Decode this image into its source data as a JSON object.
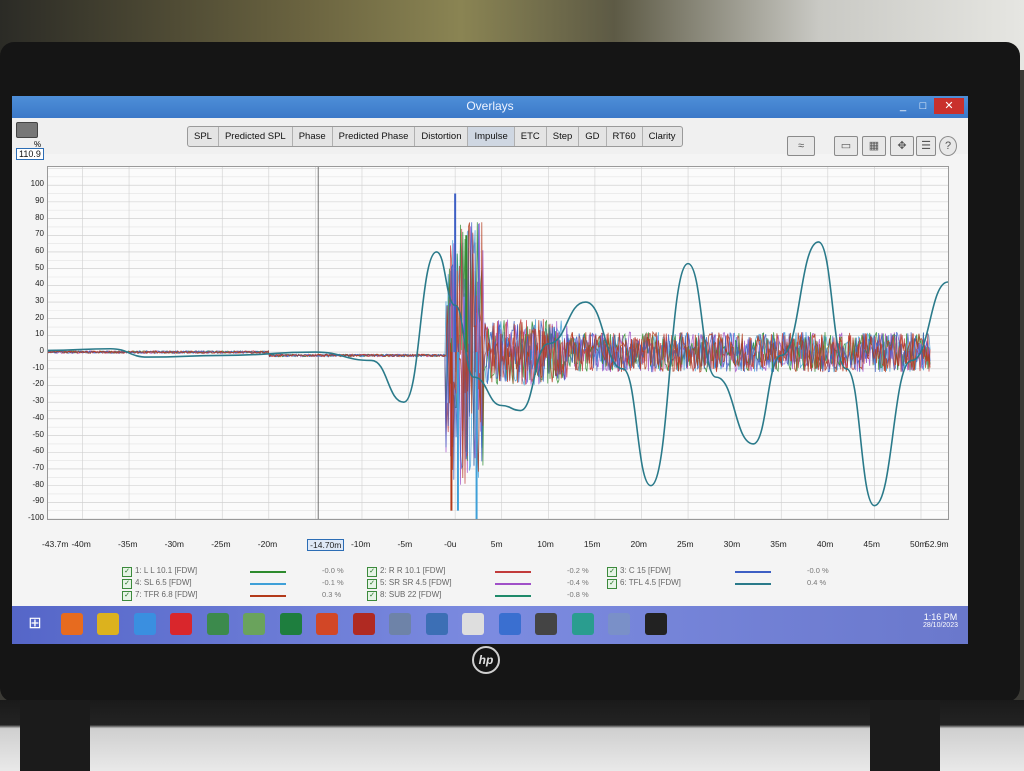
{
  "window": {
    "title": "Overlays",
    "min": "_",
    "max": "□",
    "close": "✕"
  },
  "toolbar": {
    "y_value": "110.9",
    "y_unit": "%",
    "tabs": [
      "SPL",
      "Predicted SPL",
      "Phase",
      "Predicted Phase",
      "Distortion",
      "Impulse",
      "ETC",
      "Step",
      "GD",
      "RT60",
      "Clarity"
    ],
    "active_tab": "Impulse",
    "icons": [
      "overlay-chart-icon",
      "monitor-icon",
      "grid-icon",
      "arrows-icon",
      "controls-icon",
      "help-icon"
    ]
  },
  "chart_data": {
    "type": "line",
    "ylabel": "%",
    "ylim": [
      -100,
      110.9
    ],
    "xlim": [
      -43.7,
      52.9
    ],
    "y_ticks": [
      "100",
      "90",
      "80",
      "70",
      "60",
      "50",
      "40",
      "30",
      "20",
      "10",
      "0",
      "-10",
      "-20",
      "-30",
      "-40",
      "-50",
      "-60",
      "-70",
      "-80",
      "-90",
      "-100"
    ],
    "x_ticks": [
      "-43.7m",
      "-40m",
      "-35m",
      "-30m",
      "-25m",
      "-20m",
      "-14.70m",
      "-10m",
      "-5m",
      "-0u",
      "5m",
      "10m",
      "15m",
      "20m",
      "25m",
      "30m",
      "35m",
      "40m",
      "45m",
      "50m",
      "52.9m"
    ],
    "cursor_x": "-14.70m",
    "grid": true,
    "series": [
      {
        "name": "1: L L 10.1 [FDW]",
        "color": "#2e8b2e",
        "offset": "-0.0 %"
      },
      {
        "name": "2: R R 10.1 [FDW]",
        "color": "#c23b3b",
        "offset": "-0.2 %"
      },
      {
        "name": "3: C 15 [FDW]",
        "color": "#3d5fc4",
        "offset": "-0.0 %"
      },
      {
        "name": "4: SL 6.5 [FDW]",
        "color": "#3fa0d8",
        "offset": "-0.1 %"
      },
      {
        "name": "5: SR SR 4.5 [FDW]",
        "color": "#a050c8",
        "offset": "-0.4 %"
      },
      {
        "name": "6: TFL 4.5 [FDW]",
        "color": "#2a7a8a",
        "offset": "0.4 %"
      },
      {
        "name": "7: TFR 6.8 [FDW]",
        "color": "#b33a1a",
        "offset": "0.3 %"
      },
      {
        "name": "8: SUB 22 [FDW]",
        "color": "#1f8a6a",
        "offset": "-0.8 %"
      }
    ],
    "sub_wave": {
      "x": [
        -43.7,
        -37,
        -33,
        -25,
        -15,
        -9,
        -5.5,
        -2,
        0,
        2,
        5,
        7,
        10,
        14,
        18,
        21,
        25,
        28,
        32,
        35,
        39,
        42,
        45,
        49,
        52.9
      ],
      "y": [
        1,
        2,
        -3,
        -2,
        0,
        -5,
        -30,
        60,
        28,
        -15,
        -32,
        -35,
        5,
        30,
        -10,
        -80,
        53,
        -15,
        -55,
        -2,
        66,
        -10,
        -92,
        -5,
        42
      ]
    }
  },
  "taskbar": {
    "time": "1:16 PM",
    "date": "28/10/2023",
    "apps": [
      "windows-start-icon",
      "firefox-icon",
      "chrome-icon",
      "ie-icon",
      "opera-icon",
      "publisher-icon",
      "notepad-icon",
      "excel-icon",
      "app-icon",
      "pdf-icon",
      "file-icon",
      "settings-icon",
      "explorer-icon",
      "rew-icon",
      "media-icon",
      "rotate-icon",
      "explorer2-icon",
      "terminal-icon"
    ]
  }
}
